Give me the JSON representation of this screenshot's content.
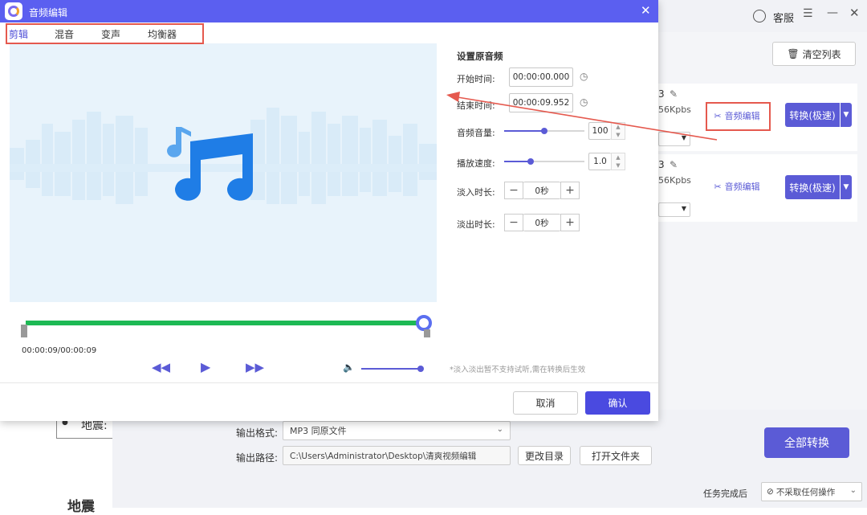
{
  "background_app": {
    "service_label": "客服",
    "clear_list_label": "清空列表",
    "rows": [
      {
        "partial_title": "3",
        "bitrate": "56Kpbs",
        "edit_label": "音频编辑",
        "convert_label": "转换(极速)"
      },
      {
        "partial_title": "3",
        "bitrate": "56Kpbs",
        "edit_label": "音频编辑",
        "convert_label": "转换(极速)"
      }
    ],
    "output_format_label": "输出格式:",
    "output_format_value": "MP3  同原文件",
    "output_path_label": "输出路径:",
    "output_path_value": "C:\\Users\\Administrator\\Desktop\\清爽视频编辑",
    "change_dir_label": "更改目录",
    "open_folder_label": "打开文件夹",
    "convert_all_label": "全部转换",
    "task_done_label": "任务完成后",
    "task_done_value": "不采取任何操作",
    "left_partial_text_1": "地震:",
    "left_partial_text_2": "地震"
  },
  "dialog": {
    "title": "音频编辑",
    "tabs": [
      "剪辑",
      "混音",
      "变声",
      "均衡器"
    ],
    "active_tab": "剪辑",
    "player": {
      "time": "00:00:09/00:00:09",
      "progress": 1.0,
      "volume": 1.0
    },
    "settings": {
      "heading": "设置原音频",
      "start_label": "开始时间:",
      "start_value": "00:00:00.000",
      "end_label": "结束时间:",
      "end_value": "00:00:09.952",
      "volume_label": "音频音量:",
      "volume_value": "100",
      "volume_level": 0.5,
      "speed_label": "播放速度:",
      "speed_value": "1.0",
      "speed_level": 0.33,
      "fade_in_label": "淡入时长:",
      "fade_in_value": "0秒",
      "fade_out_label": "淡出时长:",
      "fade_out_value": "0秒",
      "note": "*淡入淡出暂不支持试听,需在转换后生效"
    },
    "cancel_label": "取消",
    "confirm_label": "确认"
  },
  "colors": {
    "accent": "#5b5bd6",
    "title_bar": "#5b5ff0",
    "progress_green": "#1db954",
    "highlight_red": "#e5594e",
    "music_blue": "#1f7de6"
  }
}
